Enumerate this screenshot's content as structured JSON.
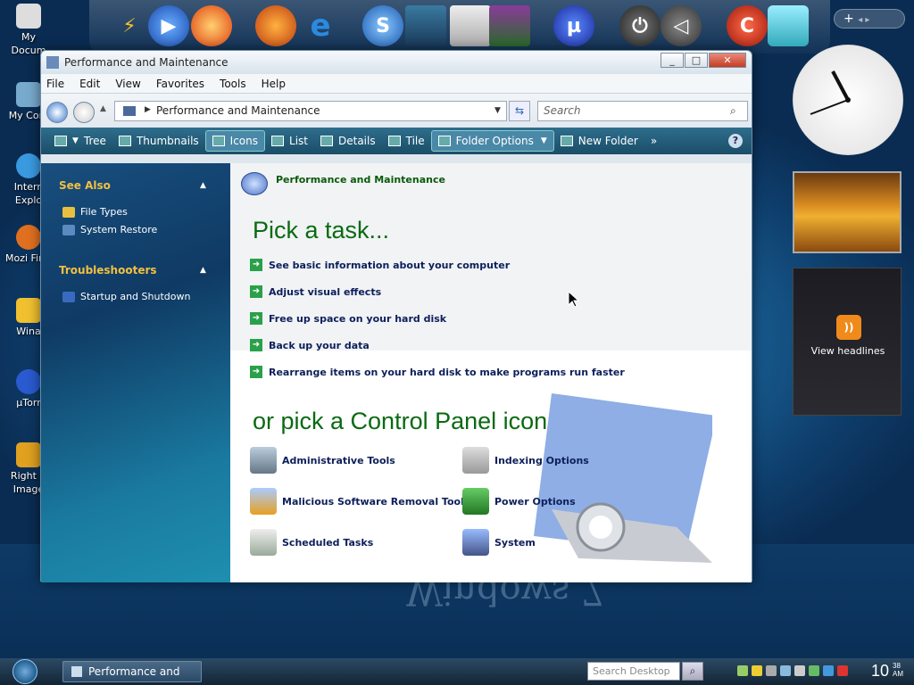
{
  "window": {
    "title": "Performance and Maintenance",
    "menu": [
      "File",
      "Edit",
      "View",
      "Favorites",
      "Tools",
      "Help"
    ],
    "address": "Performance and Maintenance",
    "search_placeholder": "Search",
    "toolbar": [
      "Tree",
      "Thumbnails",
      "Icons",
      "List",
      "Details",
      "Tile",
      "Folder Options",
      "New Folder",
      "»"
    ],
    "toolbar_selected": "Icons"
  },
  "left_panel": {
    "see_also_title": "See Also",
    "see_also": [
      "File Types",
      "System Restore"
    ],
    "troubleshooters_title": "Troubleshooters",
    "troubleshooters": [
      "Startup and Shutdown"
    ]
  },
  "content": {
    "header": "Performance and Maintenance",
    "pick_task": "Pick a task...",
    "tasks": [
      "See basic information about your computer",
      "Adjust visual effects",
      "Free up space on your hard disk",
      "Back up your data",
      "Rearrange items on your hard disk to make programs run faster"
    ],
    "pick_icon": "or pick a Control Panel icon",
    "icons": [
      "Administrative Tools",
      "Indexing Options",
      "Malicious Software Removal Tool",
      "Power Options",
      "Scheduled Tasks",
      "System"
    ]
  },
  "desktop_icons": [
    "My Docum",
    "My Com",
    "Intern Explo",
    "Mozi Firef",
    "Wina",
    "µTorr",
    "Right C Image"
  ],
  "sidebar": {
    "rss_label": "View headlines",
    "top_plus": "+"
  },
  "taskbar": {
    "window_button": "Performance and Ma...",
    "search_placeholder": "Search Desktop",
    "time": "10",
    "time_suffix_min": "38",
    "time_suffix_ampm": "AM"
  },
  "wallpaper_text": "Windows 7",
  "colors": {
    "task_green": "#0a6a12",
    "link_navy": "#0d1f5a",
    "left_heading": "#f2c040"
  }
}
